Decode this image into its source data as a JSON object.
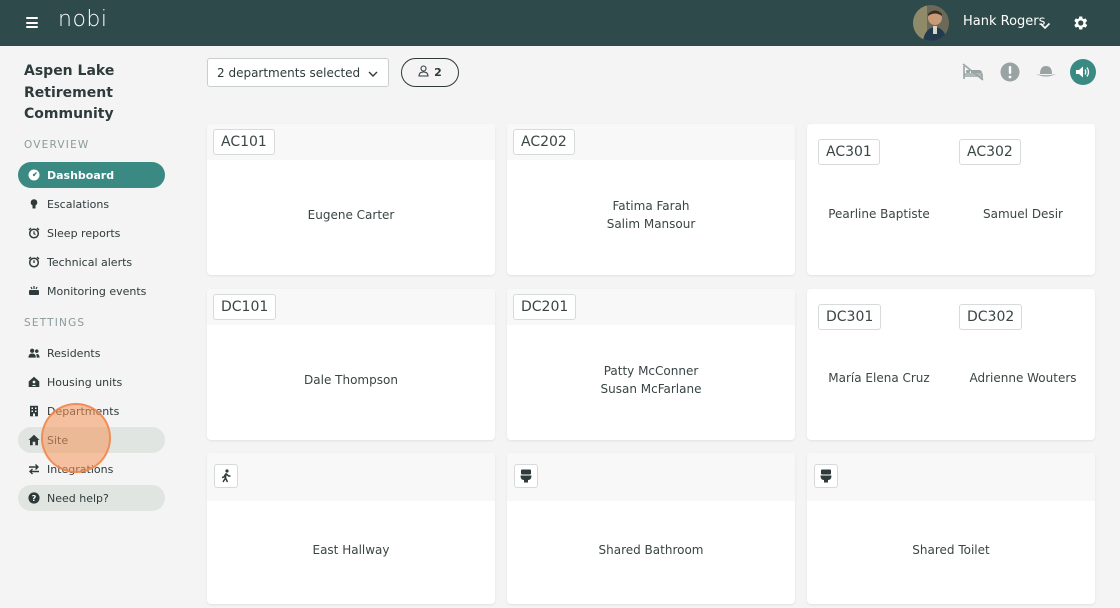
{
  "header": {
    "logo": "nobi",
    "user_name": "Hank Rogers"
  },
  "sidebar": {
    "site_name_lines": [
      "Aspen Lake",
      "Retirement",
      "Community"
    ],
    "overview_title": "OVERVIEW",
    "settings_title": "SETTINGS",
    "overview_items": [
      {
        "label": "Dashboard",
        "icon": "dashboard-icon",
        "active": true
      },
      {
        "label": "Escalations",
        "icon": "lightbulb-icon"
      },
      {
        "label": "Sleep reports",
        "icon": "alarm-clock-icon"
      },
      {
        "label": "Technical alerts",
        "icon": "alarm-icon"
      },
      {
        "label": "Monitoring events",
        "icon": "monitor-icon"
      }
    ],
    "settings_items": [
      {
        "label": "Residents",
        "icon": "people-icon"
      },
      {
        "label": "Housing units",
        "icon": "house-user-icon"
      },
      {
        "label": "Departments",
        "icon": "building-icon"
      },
      {
        "label": "Site",
        "icon": "home-icon"
      },
      {
        "label": "Integrations",
        "icon": "arrows-swap-icon"
      }
    ],
    "help_label": "Need help?"
  },
  "toolbar": {
    "department_select": "2 departments selected",
    "resident_count": "2",
    "tools": [
      "bed-icon",
      "alert-icon",
      "hat-icon",
      "sound-icon"
    ]
  },
  "rooms": [
    {
      "type": "single",
      "tag": "AC101",
      "residents": [
        "Eugene Carter"
      ]
    },
    {
      "type": "single",
      "tag": "AC202",
      "residents": [
        "Fatima Farah",
        "Salim Mansour"
      ]
    },
    {
      "type": "split",
      "units": [
        {
          "tag": "AC301",
          "resident": "Pearline Baptiste"
        },
        {
          "tag": "AC302",
          "resident": "Samuel Desir"
        }
      ]
    },
    {
      "type": "single",
      "tag": "DC101",
      "residents": [
        "Dale Thompson"
      ]
    },
    {
      "type": "single",
      "tag": "DC201",
      "residents": [
        "Patty McConner",
        "Susan McFarlane"
      ]
    },
    {
      "type": "split",
      "units": [
        {
          "tag": "DC301",
          "resident": "María Elena Cruz"
        },
        {
          "tag": "DC302",
          "resident": "Adrienne Wouters"
        }
      ]
    },
    {
      "type": "area",
      "icon": "walking-person-icon",
      "name": "East Hallway"
    },
    {
      "type": "area",
      "icon": "toilet-icon",
      "name": "Shared Bathroom"
    },
    {
      "type": "area",
      "icon": "toilet-icon",
      "name": "Shared Toilet"
    }
  ],
  "colors": {
    "topbar": "#2e4a4a",
    "accent": "#3a8a83",
    "background": "#f4f4f4"
  }
}
